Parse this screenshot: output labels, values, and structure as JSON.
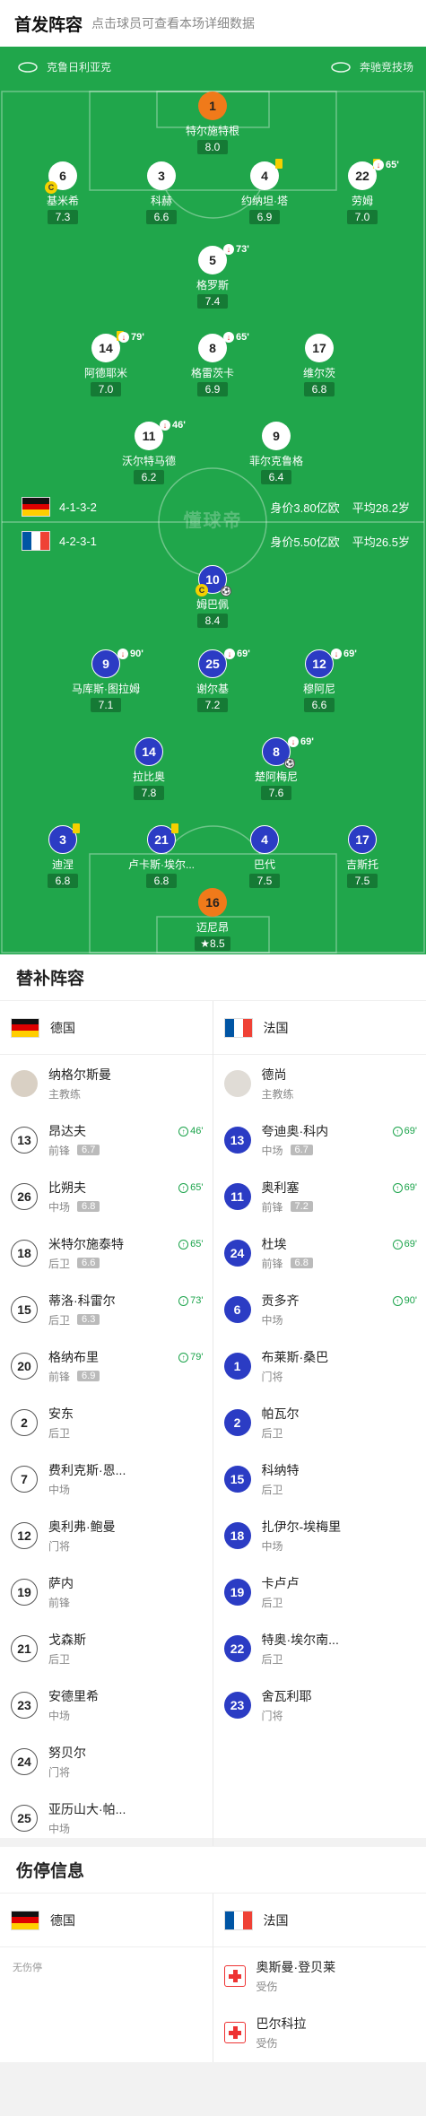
{
  "header": {
    "title": "首发阵容",
    "subtitle": "点击球员可查看本场详细数据"
  },
  "colors": {
    "pitch": "#20a64b",
    "home_kit": "#ffffff",
    "away_kit": "#2b3cc4",
    "goalkeeper": "#f07a1a"
  },
  "pitch": {
    "home_stadium": "克鲁日利亚克",
    "away_stadium": "奔驰竞技场",
    "watermark": "懂球帝",
    "home": {
      "formation": "4-1-3-2",
      "value": "身价3.80亿欧",
      "avg_age": "平均28.2岁"
    },
    "away": {
      "formation": "4-2-3-1",
      "value": "身价5.50亿欧",
      "avg_age": "平均26.5岁"
    }
  },
  "home_players": [
    {
      "num": "1",
      "name": "特尔施特根",
      "rating": "8.0"
    },
    {
      "num": "6",
      "name": "基米希",
      "rating": "7.3",
      "captain": "C"
    },
    {
      "num": "3",
      "name": "科赫",
      "rating": "6.6"
    },
    {
      "num": "4",
      "name": "约纳坦·塔",
      "rating": "6.9"
    },
    {
      "num": "22",
      "name": "劳姆",
      "rating": "7.0",
      "sub": "65'"
    },
    {
      "num": "5",
      "name": "格罗斯",
      "rating": "7.4",
      "sub": "73'"
    },
    {
      "num": "14",
      "name": "阿德耶米",
      "rating": "7.0",
      "sub": "79'"
    },
    {
      "num": "8",
      "name": "格雷茨卡",
      "rating": "6.9",
      "sub": "65'"
    },
    {
      "num": "17",
      "name": "维尔茨",
      "rating": "6.8"
    },
    {
      "num": "11",
      "name": "沃尔特马德",
      "rating": "6.2",
      "sub": "46'"
    },
    {
      "num": "9",
      "name": "菲尔克鲁格",
      "rating": "6.4"
    }
  ],
  "away_players": [
    {
      "num": "10",
      "name": "姆巴佩",
      "rating": "8.4",
      "captain": "C"
    },
    {
      "num": "9",
      "name": "马库斯·图拉姆",
      "rating": "7.1",
      "sub": "90'"
    },
    {
      "num": "25",
      "name": "谢尔基",
      "rating": "7.2",
      "sub": "69'"
    },
    {
      "num": "12",
      "name": "穆阿尼",
      "rating": "6.6",
      "sub": "69'"
    },
    {
      "num": "14",
      "name": "拉比奥",
      "rating": "7.8"
    },
    {
      "num": "8",
      "name": "楚阿梅尼",
      "rating": "7.6",
      "sub": "69'"
    },
    {
      "num": "3",
      "name": "迪涅",
      "rating": "6.8"
    },
    {
      "num": "21",
      "name": "卢卡斯·埃尔...",
      "rating": "6.8"
    },
    {
      "num": "4",
      "name": "巴代",
      "rating": "7.5"
    },
    {
      "num": "17",
      "name": "吉斯托",
      "rating": "7.5"
    },
    {
      "num": "16",
      "name": "迈尼昂",
      "rating": "8.5"
    }
  ],
  "subs": {
    "title": "替补阵容",
    "home_team": "德国",
    "away_team": "法国",
    "home_coach": {
      "name": "纳格尔斯曼",
      "role": "主教练"
    },
    "away_coach": {
      "name": "德尚",
      "role": "主教练"
    },
    "home": [
      {
        "num": "13",
        "name": "昂达夫",
        "pos": "前锋",
        "rating": "6.7",
        "time": "46'"
      },
      {
        "num": "26",
        "name": "比朔夫",
        "pos": "中场",
        "rating": "6.8",
        "time": "65'"
      },
      {
        "num": "18",
        "name": "米特尔施泰特",
        "pos": "后卫",
        "rating": "6.6",
        "time": "65'"
      },
      {
        "num": "15",
        "name": "蒂洛·科雷尔",
        "pos": "后卫",
        "rating": "6.3",
        "time": "73'"
      },
      {
        "num": "20",
        "name": "格纳布里",
        "pos": "前锋",
        "rating": "6.9",
        "time": "79'"
      },
      {
        "num": "2",
        "name": "安东",
        "pos": "后卫"
      },
      {
        "num": "7",
        "name": "费利克斯·恩...",
        "pos": "中场"
      },
      {
        "num": "12",
        "name": "奥利弗·鲍曼",
        "pos": "门将"
      },
      {
        "num": "19",
        "name": "萨内",
        "pos": "前锋"
      },
      {
        "num": "21",
        "name": "戈森斯",
        "pos": "后卫"
      },
      {
        "num": "23",
        "name": "安德里希",
        "pos": "中场"
      },
      {
        "num": "24",
        "name": "努贝尔",
        "pos": "门将"
      },
      {
        "num": "25",
        "name": "亚历山大·帕...",
        "pos": "中场"
      }
    ],
    "away": [
      {
        "num": "13",
        "name": "夸迪奥·科内",
        "pos": "中场",
        "rating": "6.7",
        "time": "69'"
      },
      {
        "num": "11",
        "name": "奥利塞",
        "pos": "前锋",
        "rating": "7.2",
        "time": "69'"
      },
      {
        "num": "24",
        "name": "杜埃",
        "pos": "前锋",
        "rating": "6.8",
        "time": "69'"
      },
      {
        "num": "6",
        "name": "贡多齐",
        "pos": "中场",
        "time": "90'"
      },
      {
        "num": "1",
        "name": "布莱斯·桑巴",
        "pos": "门将"
      },
      {
        "num": "2",
        "name": "帕瓦尔",
        "pos": "后卫"
      },
      {
        "num": "15",
        "name": "科纳特",
        "pos": "后卫"
      },
      {
        "num": "18",
        "name": "扎伊尔-埃梅里",
        "pos": "中场"
      },
      {
        "num": "19",
        "name": "卡卢卢",
        "pos": "后卫"
      },
      {
        "num": "22",
        "name": "特奥·埃尔南...",
        "pos": "后卫"
      },
      {
        "num": "23",
        "name": "舍瓦利耶",
        "pos": "门将"
      }
    ]
  },
  "injuries": {
    "title": "伤停信息",
    "home_team": "德国",
    "away_team": "法国",
    "home_none": "无伤停",
    "away": [
      {
        "name": "奥斯曼·登贝莱",
        "status": "受伤"
      },
      {
        "name": "巴尔科拉",
        "status": "受伤"
      }
    ]
  }
}
